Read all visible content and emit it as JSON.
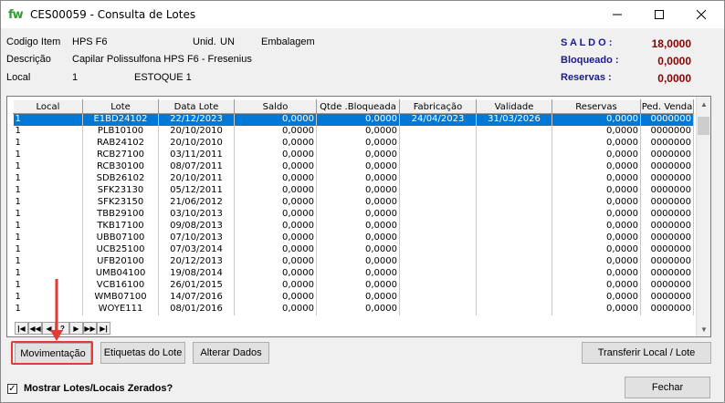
{
  "window": {
    "app_icon": "fw",
    "title": "CES00059 - Consulta de Lotes"
  },
  "info": {
    "codigo_label": "Codigo Item",
    "codigo_value": "HPS F6",
    "unid_label": "Unid.",
    "unid_value": "UN",
    "embalagem_label": "Embalagem",
    "descricao_label": "Descrição",
    "descricao_value": "Capilar Polissulfona HPS F6 - Fresenius",
    "local_label": "Local",
    "local_value": "1",
    "local_name": "ESTOQUE 1"
  },
  "totals": {
    "saldo_label": "S A L D O :",
    "saldo_value": "18,0000",
    "bloqueado_label": "Bloqueado :",
    "bloqueado_value": "0,0000",
    "reservas_label": "Reservas :",
    "reservas_value": "0,0000"
  },
  "grid": {
    "columns": [
      "Local",
      "Lote",
      "Data Lote",
      "Saldo",
      "Qtde .Bloqueada",
      "Fabricação",
      "Validade",
      "Reservas",
      "Ped. Venda"
    ],
    "rows": [
      [
        "1",
        "E1BD24102",
        "22/12/2023",
        "0,0000",
        "0,0000",
        "24/04/2023",
        "31/03/2026",
        "0,0000",
        "0000000"
      ],
      [
        "1",
        "PLB10100",
        "20/10/2010",
        "0,0000",
        "0,0000",
        "",
        "",
        "0,0000",
        "0000000"
      ],
      [
        "1",
        "RAB24102",
        "20/10/2010",
        "0,0000",
        "0,0000",
        "",
        "",
        "0,0000",
        "0000000"
      ],
      [
        "1",
        "RCB27100",
        "03/11/2011",
        "0,0000",
        "0,0000",
        "",
        "",
        "0,0000",
        "0000000"
      ],
      [
        "1",
        "RCB30100",
        "08/07/2011",
        "0,0000",
        "0,0000",
        "",
        "",
        "0,0000",
        "0000000"
      ],
      [
        "1",
        "SDB26102",
        "20/10/2011",
        "0,0000",
        "0,0000",
        "",
        "",
        "0,0000",
        "0000000"
      ],
      [
        "1",
        "SFK23130",
        "05/12/2011",
        "0,0000",
        "0,0000",
        "",
        "",
        "0,0000",
        "0000000"
      ],
      [
        "1",
        "SFK23150",
        "21/06/2012",
        "0,0000",
        "0,0000",
        "",
        "",
        "0,0000",
        "0000000"
      ],
      [
        "1",
        "TBB29100",
        "03/10/2013",
        "0,0000",
        "0,0000",
        "",
        "",
        "0,0000",
        "0000000"
      ],
      [
        "1",
        "TKB17100",
        "09/08/2013",
        "0,0000",
        "0,0000",
        "",
        "",
        "0,0000",
        "0000000"
      ],
      [
        "1",
        "UBB07100",
        "07/10/2013",
        "0,0000",
        "0,0000",
        "",
        "",
        "0,0000",
        "0000000"
      ],
      [
        "1",
        "UCB25100",
        "07/03/2014",
        "0,0000",
        "0,0000",
        "",
        "",
        "0,0000",
        "0000000"
      ],
      [
        "1",
        "UFB20100",
        "20/12/2013",
        "0,0000",
        "0,0000",
        "",
        "",
        "0,0000",
        "0000000"
      ],
      [
        "1",
        "UMB04100",
        "19/08/2014",
        "0,0000",
        "0,0000",
        "",
        "",
        "0,0000",
        "0000000"
      ],
      [
        "1",
        "VCB16100",
        "26/01/2015",
        "0,0000",
        "0,0000",
        "",
        "",
        "0,0000",
        "0000000"
      ],
      [
        "1",
        "WMB07100",
        "14/07/2016",
        "0,0000",
        "0,0000",
        "",
        "",
        "0,0000",
        "0000000"
      ],
      [
        "1",
        "WOYE111",
        "08/01/2016",
        "0,0000",
        "0,0000",
        "",
        "",
        "0,0000",
        "0000000"
      ]
    ],
    "selected_row": 0
  },
  "navigator": [
    "|◀",
    "◀◀",
    "◀",
    "?",
    "▶",
    "▶▶",
    "▶|"
  ],
  "buttons": {
    "movimentacao": "Movimentação",
    "etiquetas": "Etiquetas do Lote",
    "alterar": "Alterar Dados",
    "transferir": "Transferir Local / Lote",
    "fechar": "Fechar"
  },
  "checkbox": {
    "checked_mark": "✓",
    "label": "Mostrar Lotes/Locais Zerados?"
  },
  "colors": {
    "accent_selection": "#0078d7",
    "saldo_label": "#1a1a8a",
    "saldo_value": "#8b0000",
    "annotation": "#e53935"
  }
}
